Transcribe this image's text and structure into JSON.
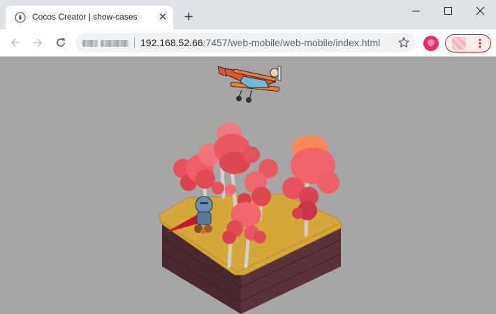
{
  "tab": {
    "title": "Cocos Creator | show-cases",
    "close_glyph": "✕"
  },
  "new_tab_glyph": "+",
  "window_controls": {
    "minimize": "minimize-icon",
    "maximize": "maximize-icon",
    "close": "close-icon"
  },
  "address_bar": {
    "host": "192.168.52.66",
    "rest": ":7457/web-mobile/web-mobile/index.html"
  },
  "colors": {
    "titlebar": "#dee1e6",
    "game_background": "#a6a6a6",
    "profile_accent": "#c5221f",
    "tree_red": "#e8505a",
    "ground_yellow": "#d4a83a"
  },
  "scene": {
    "description_icons": [
      "biplane",
      "tree-cluster",
      "knight-character",
      "island-platform"
    ]
  }
}
